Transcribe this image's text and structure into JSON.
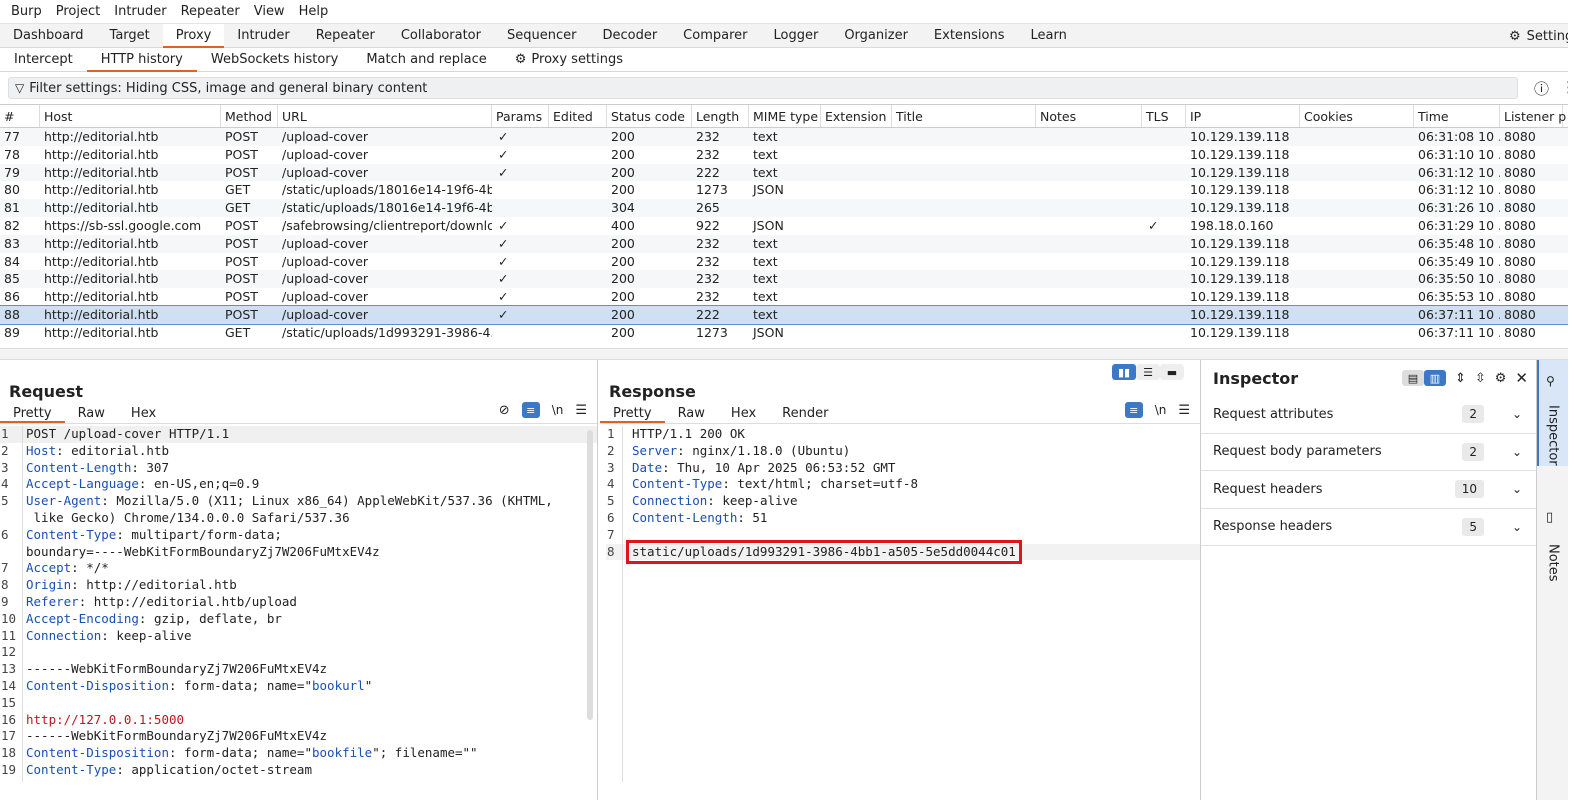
{
  "menubar": [
    "Burp",
    "Project",
    "Intruder",
    "Repeater",
    "View",
    "Help"
  ],
  "top_tabs": [
    "Dashboard",
    "Target",
    "Proxy",
    "Intruder",
    "Repeater",
    "Collaborator",
    "Sequencer",
    "Decoder",
    "Comparer",
    "Logger",
    "Organizer",
    "Extensions",
    "Learn"
  ],
  "active_top_tab": "Proxy",
  "settings_label": "Settings",
  "sub_tabs": [
    "Intercept",
    "HTTP history",
    "WebSockets history",
    "Match and replace"
  ],
  "active_sub_tab": "HTTP history",
  "proxy_settings_label": "Proxy settings",
  "filter_text": "Filter settings: Hiding CSS, image and general binary content",
  "history": {
    "columns": [
      "#",
      "Host",
      "Method",
      "URL",
      "Params",
      "Edited",
      "Status code",
      "Length",
      "MIME type",
      "Extension",
      "Title",
      "Notes",
      "TLS",
      "IP",
      "Cookies",
      "Time",
      "Listener p"
    ],
    "rows": [
      [
        "77",
        "http://editorial.htb",
        "POST",
        "/upload-cover",
        "✓",
        "",
        "200",
        "232",
        "text",
        "",
        "",
        "",
        "",
        "10.129.139.118",
        "",
        "06:31:08 10 ...",
        "8080"
      ],
      [
        "78",
        "http://editorial.htb",
        "POST",
        "/upload-cover",
        "✓",
        "",
        "200",
        "232",
        "text",
        "",
        "",
        "",
        "",
        "10.129.139.118",
        "",
        "06:31:10 10 ...",
        "8080"
      ],
      [
        "79",
        "http://editorial.htb",
        "POST",
        "/upload-cover",
        "✓",
        "",
        "200",
        "222",
        "text",
        "",
        "",
        "",
        "",
        "10.129.139.118",
        "",
        "06:31:12 10 ...",
        "8080"
      ],
      [
        "80",
        "http://editorial.htb",
        "GET",
        "/static/uploads/18016e14-19f6-4b...",
        "",
        "",
        "200",
        "1273",
        "JSON",
        "",
        "",
        "",
        "",
        "10.129.139.118",
        "",
        "06:31:12 10 ...",
        "8080"
      ],
      [
        "81",
        "http://editorial.htb",
        "GET",
        "/static/uploads/18016e14-19f6-4b...",
        "",
        "",
        "304",
        "265",
        "",
        "",
        "",
        "",
        "",
        "10.129.139.118",
        "",
        "06:31:26 10 ...",
        "8080"
      ],
      [
        "82",
        "https://sb-ssl.google.com",
        "POST",
        "/safebrowsing/clientreport/downlo...",
        "✓",
        "",
        "400",
        "922",
        "JSON",
        "",
        "",
        "",
        "✓",
        "198.18.0.160",
        "",
        "06:31:29 10 ...",
        "8080"
      ],
      [
        "83",
        "http://editorial.htb",
        "POST",
        "/upload-cover",
        "✓",
        "",
        "200",
        "232",
        "text",
        "",
        "",
        "",
        "",
        "10.129.139.118",
        "",
        "06:35:48 10 ...",
        "8080"
      ],
      [
        "84",
        "http://editorial.htb",
        "POST",
        "/upload-cover",
        "✓",
        "",
        "200",
        "232",
        "text",
        "",
        "",
        "",
        "",
        "10.129.139.118",
        "",
        "06:35:49 10 ...",
        "8080"
      ],
      [
        "85",
        "http://editorial.htb",
        "POST",
        "/upload-cover",
        "✓",
        "",
        "200",
        "232",
        "text",
        "",
        "",
        "",
        "",
        "10.129.139.118",
        "",
        "06:35:50 10 ...",
        "8080"
      ],
      [
        "86",
        "http://editorial.htb",
        "POST",
        "/upload-cover",
        "✓",
        "",
        "200",
        "232",
        "text",
        "",
        "",
        "",
        "",
        "10.129.139.118",
        "",
        "06:35:53 10 ...",
        "8080"
      ],
      [
        "88",
        "http://editorial.htb",
        "POST",
        "/upload-cover",
        "✓",
        "",
        "200",
        "222",
        "text",
        "",
        "",
        "",
        "",
        "10.129.139.118",
        "",
        "06:37:11 10 ...",
        "8080"
      ],
      [
        "89",
        "http://editorial.htb",
        "GET",
        "/static/uploads/1d993291-3986-4...",
        "",
        "",
        "200",
        "1273",
        "JSON",
        "",
        "",
        "",
        "",
        "10.129.139.118",
        "",
        "06:37:11 10 ...",
        "8080"
      ]
    ],
    "selected_row": "88"
  },
  "request": {
    "title": "Request",
    "tabs": [
      "Pretty",
      "Raw",
      "Hex"
    ],
    "active_tab": "Pretty",
    "lines": [
      {
        "n": "1",
        "parts": [
          [
            "t",
            "POST /upload-cover HTTP/1.1"
          ]
        ]
      },
      {
        "n": "2",
        "parts": [
          [
            "k",
            "Host"
          ],
          [
            "t",
            ": editorial.htb"
          ]
        ]
      },
      {
        "n": "3",
        "parts": [
          [
            "k",
            "Content-Length"
          ],
          [
            "t",
            ": 307"
          ]
        ]
      },
      {
        "n": "4",
        "parts": [
          [
            "k",
            "Accept-Language"
          ],
          [
            "t",
            ": en-US,en;q=0.9"
          ]
        ]
      },
      {
        "n": "5",
        "parts": [
          [
            "k",
            "User-Agent"
          ],
          [
            "t",
            ": Mozilla/5.0 (X11; Linux x86_64) AppleWebKit/537.36 (KHTML,"
          ]
        ]
      },
      {
        "n": "",
        "parts": [
          [
            "t",
            " like Gecko) Chrome/134.0.0.0 Safari/537.36"
          ]
        ]
      },
      {
        "n": "6",
        "parts": [
          [
            "k",
            "Content-Type"
          ],
          [
            "t",
            ": multipart/form-data;"
          ]
        ]
      },
      {
        "n": "",
        "parts": [
          [
            "t",
            "boundary=----WebKitFormBoundaryZj7W206FuMtxEV4z"
          ]
        ]
      },
      {
        "n": "7",
        "parts": [
          [
            "k",
            "Accept"
          ],
          [
            "t",
            ": */*"
          ]
        ]
      },
      {
        "n": "8",
        "parts": [
          [
            "k",
            "Origin"
          ],
          [
            "t",
            ": http://editorial.htb"
          ]
        ]
      },
      {
        "n": "9",
        "parts": [
          [
            "k",
            "Referer"
          ],
          [
            "t",
            ": http://editorial.htb/upload"
          ]
        ]
      },
      {
        "n": "10",
        "parts": [
          [
            "k",
            "Accept-Encoding"
          ],
          [
            "t",
            ": gzip, deflate, br"
          ]
        ]
      },
      {
        "n": "11",
        "parts": [
          [
            "k",
            "Connection"
          ],
          [
            "t",
            ": keep-alive"
          ]
        ]
      },
      {
        "n": "12",
        "parts": [
          [
            "t",
            ""
          ]
        ]
      },
      {
        "n": "13",
        "parts": [
          [
            "t",
            "------WebKitFormBoundaryZj7W206FuMtxEV4z"
          ]
        ]
      },
      {
        "n": "14",
        "parts": [
          [
            "k",
            "Content-Disposition"
          ],
          [
            "t",
            ": form-data; name=\""
          ],
          [
            "b",
            "bookurl"
          ],
          [
            "t",
            "\""
          ]
        ]
      },
      {
        "n": "15",
        "parts": [
          [
            "t",
            ""
          ]
        ]
      },
      {
        "n": "16",
        "parts": [
          [
            "r",
            "http://127.0.0.1:5000"
          ]
        ]
      },
      {
        "n": "17",
        "parts": [
          [
            "t",
            "------WebKitFormBoundaryZj7W206FuMtxEV4z"
          ]
        ]
      },
      {
        "n": "18",
        "parts": [
          [
            "k",
            "Content-Disposition"
          ],
          [
            "t",
            ": form-data; name=\""
          ],
          [
            "b",
            "bookfile"
          ],
          [
            "t",
            "\"; filename=\"\""
          ]
        ]
      },
      {
        "n": "19",
        "parts": [
          [
            "k",
            "Content-Type"
          ],
          [
            "t",
            ": application/octet-stream"
          ]
        ]
      }
    ]
  },
  "response": {
    "title": "Response",
    "tabs": [
      "Pretty",
      "Raw",
      "Hex",
      "Render"
    ],
    "active_tab": "Pretty",
    "lines": [
      {
        "n": "1",
        "parts": [
          [
            "t",
            "HTTP/1.1 200 OK"
          ]
        ]
      },
      {
        "n": "2",
        "parts": [
          [
            "k",
            "Server"
          ],
          [
            "t",
            ": nginx/1.18.0 (Ubuntu)"
          ]
        ]
      },
      {
        "n": "3",
        "parts": [
          [
            "k",
            "Date"
          ],
          [
            "t",
            ": Thu, 10 Apr 2025 06:53:52 GMT"
          ]
        ]
      },
      {
        "n": "4",
        "parts": [
          [
            "k",
            "Content-Type"
          ],
          [
            "t",
            ": text/html; charset=utf-8"
          ]
        ]
      },
      {
        "n": "5",
        "parts": [
          [
            "k",
            "Connection"
          ],
          [
            "t",
            ": keep-alive"
          ]
        ]
      },
      {
        "n": "6",
        "parts": [
          [
            "k",
            "Content-Length"
          ],
          [
            "t",
            ": 51"
          ]
        ]
      },
      {
        "n": "7",
        "parts": [
          [
            "t",
            ""
          ]
        ]
      },
      {
        "n": "8",
        "parts": [
          [
            "t",
            "static/uploads/1d993291-3986-4bb1-a505-5e5dd0044c01"
          ]
        ],
        "highlight": true
      }
    ]
  },
  "inspector": {
    "title": "Inspector",
    "sections": [
      {
        "label": "Request attributes",
        "count": "2"
      },
      {
        "label": "Request body parameters",
        "count": "2"
      },
      {
        "label": "Request headers",
        "count": "10"
      },
      {
        "label": "Response headers",
        "count": "5"
      }
    ]
  },
  "sidebar_tabs": [
    "Inspector",
    "Notes"
  ],
  "colors": {
    "accent": "#e06026",
    "selection": "#cfdff4",
    "header_key": "#1a4fb3",
    "highlight_box": "#e0141c"
  }
}
